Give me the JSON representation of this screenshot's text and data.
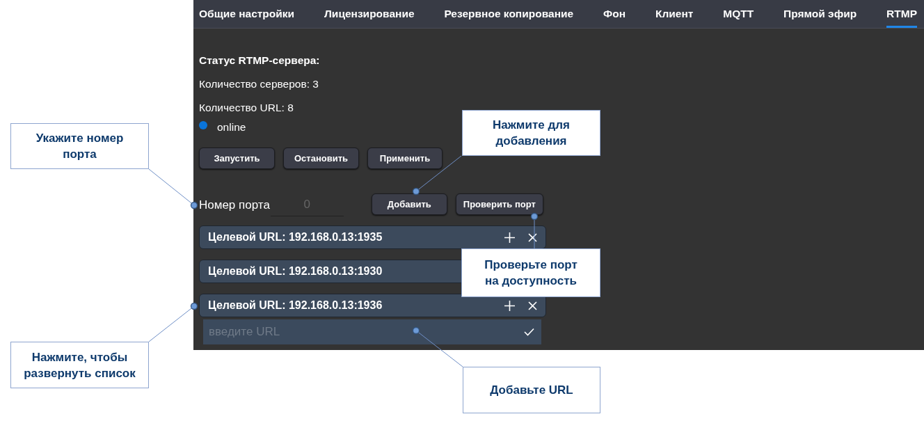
{
  "tabs": [
    {
      "label": "Общие настройки",
      "selected": false
    },
    {
      "label": "Лицензирование",
      "selected": false
    },
    {
      "label": "Резервное копирование",
      "selected": false
    },
    {
      "label": "Фон",
      "selected": false
    },
    {
      "label": "Клиент",
      "selected": false
    },
    {
      "label": "MQTT",
      "selected": false
    },
    {
      "label": "Прямой эфир",
      "selected": false
    },
    {
      "label": "RTMP",
      "selected": true
    }
  ],
  "status": {
    "title": "Статус RTMP-сервера:",
    "servers": "Количество серверов: 3",
    "urls": "Количество URL: 8",
    "state": "online",
    "color": "#0a74d9"
  },
  "server_buttons": [
    "Запустить",
    "Остановить",
    "Применить"
  ],
  "port": {
    "label": "Номер порта",
    "placeholder": "0"
  },
  "port_buttons": [
    "Добавить",
    "Проверить порт"
  ],
  "targets": [
    {
      "label": "Целевой URL: 192.168.0.13:1935",
      "actions": true,
      "expanded": false
    },
    {
      "label": "Целевой URL: 192.168.0.13:1930",
      "expanded": false
    },
    {
      "label": "Целевой URL: 192.168.0.13:1936",
      "actions": true,
      "expanded": true
    }
  ],
  "url_input": {
    "placeholder": "введите URL"
  },
  "callouts": [
    {
      "text": "Укажите номер порта"
    },
    {
      "text": "Нажмите для добавления"
    },
    {
      "text": "Проверьте порт на доступность"
    },
    {
      "text": "Нажмите, чтобы развернуть список"
    },
    {
      "text": "Добавьте URL"
    }
  ]
}
